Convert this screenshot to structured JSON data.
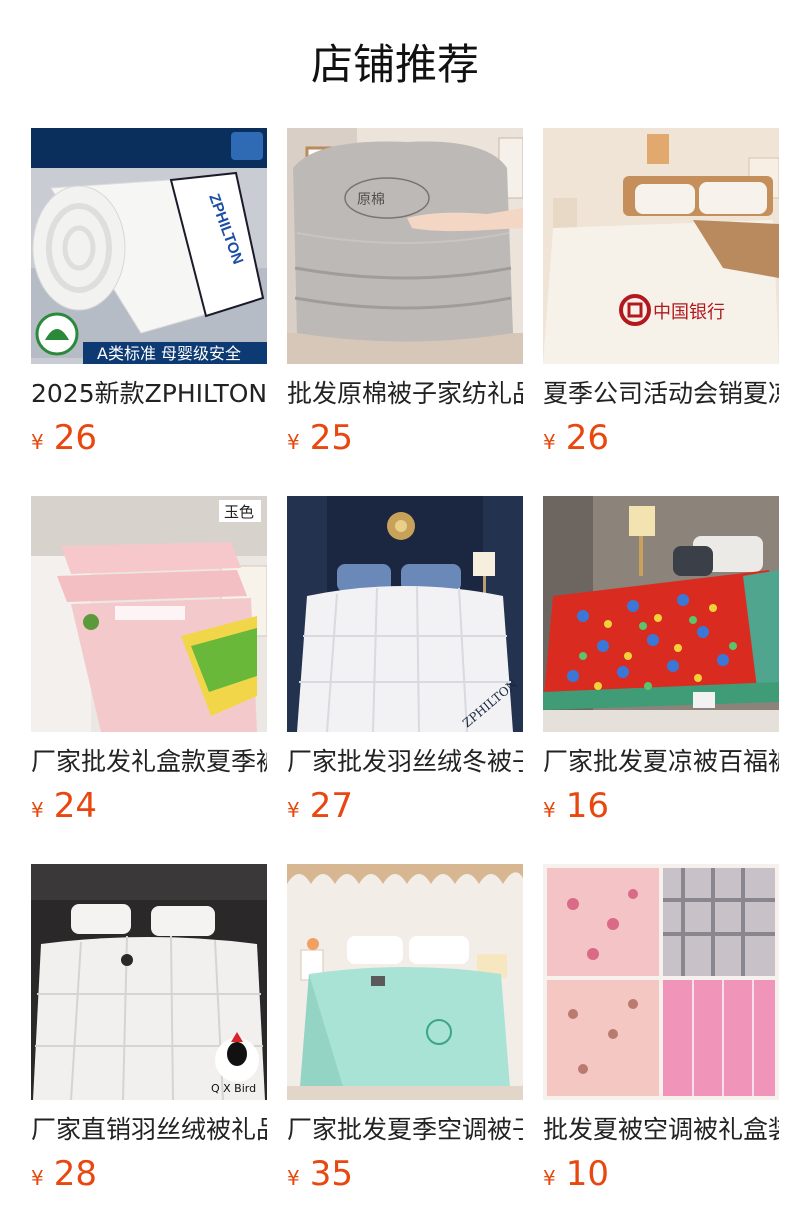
{
  "section": {
    "title": "店铺推荐"
  },
  "currency_symbol": "¥",
  "products": [
    {
      "title": "2025新款ZPHILTON",
      "price": "26",
      "image": {
        "icon": "rolled-quilt-image",
        "banner_text": "A类标准 母婴级安全",
        "label_text": "ZPHILTON",
        "colors": {
          "bg": "#c9ccd2",
          "item": "#f4f4f2",
          "banner": "#0d3a73"
        }
      }
    },
    {
      "title": "批发原棉被子家纺礼品",
      "price": "25",
      "image": {
        "icon": "folded-quilt-image",
        "colors": {
          "bg": "#e9ded6",
          "item": "#b9b6b3"
        }
      }
    },
    {
      "title": "夏季公司活动会销夏凉被",
      "price": "26",
      "image": {
        "icon": "bed-with-bank-logo-image",
        "label_text": "中国银行",
        "colors": {
          "bg": "#efe4d5",
          "item": "#f5f1e8",
          "accent": "#b3181e"
        }
      }
    },
    {
      "title": "厂家批发礼盒款夏季被",
      "price": "24",
      "image": {
        "icon": "pink-quilt-image",
        "corner_text": "玉色",
        "colors": {
          "bg": "#e8e4e0",
          "item": "#f4c9cc"
        }
      }
    },
    {
      "title": "厂家批发羽丝绒冬被子",
      "price": "27",
      "image": {
        "icon": "white-duvet-image",
        "label_text": "ZPHILTON",
        "colors": {
          "bg": "#1f2c44",
          "item": "#f2f2f4"
        }
      }
    },
    {
      "title": "厂家批发夏凉被百福被",
      "price": "16",
      "image": {
        "icon": "red-floral-quilt-image",
        "colors": {
          "bg": "#8a8178",
          "item": "#d92b1f"
        }
      }
    },
    {
      "title": "厂家直销羽丝绒被礼品被",
      "price": "28",
      "image": {
        "icon": "white-down-duvet-image",
        "label_text": "Q X Bird",
        "colors": {
          "bg": "#2c2a2a",
          "item": "#f1f0ee"
        }
      }
    },
    {
      "title": "厂家批发夏季空调被子",
      "price": "35",
      "image": {
        "icon": "mint-quilt-image",
        "colors": {
          "bg": "#f2ece6",
          "item": "#a9e3d6"
        }
      }
    },
    {
      "title": "批发夏被空调被礼盒装",
      "price": "10",
      "image": {
        "icon": "four-quilts-collage-image",
        "colors": {
          "bg": "#f7f1ee",
          "item": "#f3c3c6"
        }
      }
    }
  ]
}
